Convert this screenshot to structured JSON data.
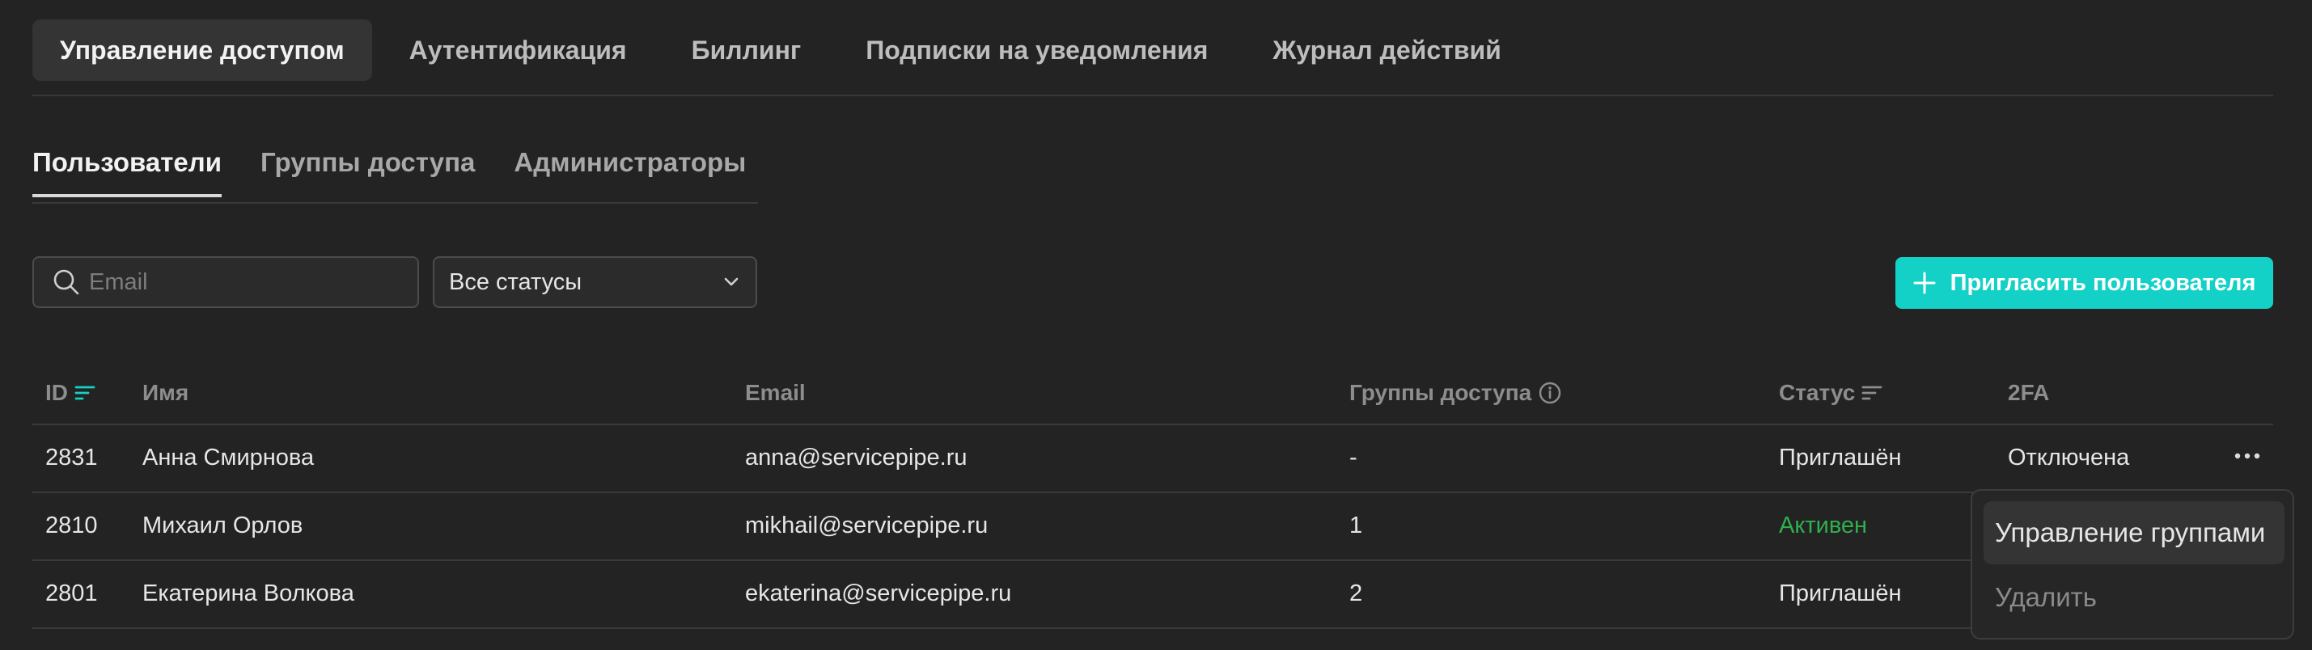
{
  "top_tabs": [
    {
      "label": "Управление доступом",
      "active": true
    },
    {
      "label": "Аутентификация",
      "active": false
    },
    {
      "label": "Биллинг",
      "active": false
    },
    {
      "label": "Подписки на уведомления",
      "active": false
    },
    {
      "label": "Журнал действий",
      "active": false
    }
  ],
  "sub_tabs": [
    {
      "label": "Пользователи",
      "active": true
    },
    {
      "label": "Группы доступа",
      "active": false
    },
    {
      "label": "Администраторы",
      "active": false
    }
  ],
  "filters": {
    "search_placeholder": "Email",
    "search_value": "",
    "status_selected": "Все статусы"
  },
  "invite_button": "Пригласить пользователя",
  "table": {
    "columns": {
      "id": "ID",
      "name": "Имя",
      "email": "Email",
      "groups": "Группы доступа",
      "status": "Статус",
      "twofa": "2FA"
    },
    "rows": [
      {
        "id": "2831",
        "name": "Анна Смирнова",
        "email": "anna@servicepipe.ru",
        "groups": "-",
        "status": "Приглашён",
        "twofa": "Отключена"
      },
      {
        "id": "2810",
        "name": "Михаил Орлов",
        "email": "mikhail@servicepipe.ru",
        "groups": "1",
        "status": "Активен",
        "twofa": ""
      },
      {
        "id": "2801",
        "name": "Екатерина Волкова",
        "email": "ekaterina@servicepipe.ru",
        "groups": "2",
        "status": "Приглашён",
        "twofa": ""
      }
    ]
  },
  "row_menu": {
    "items": [
      "Управление группами",
      "Удалить"
    ]
  },
  "colors": {
    "accent": "#14d1c7",
    "active_status": "#2fb04e",
    "background": "#232323"
  },
  "icons": {
    "search": "search-icon",
    "select_arrow": "chevron-down-icon",
    "invite": "plus-icon",
    "sort": "sort-icon",
    "info": "info-icon",
    "row_actions": "more-horizontal-icon"
  }
}
